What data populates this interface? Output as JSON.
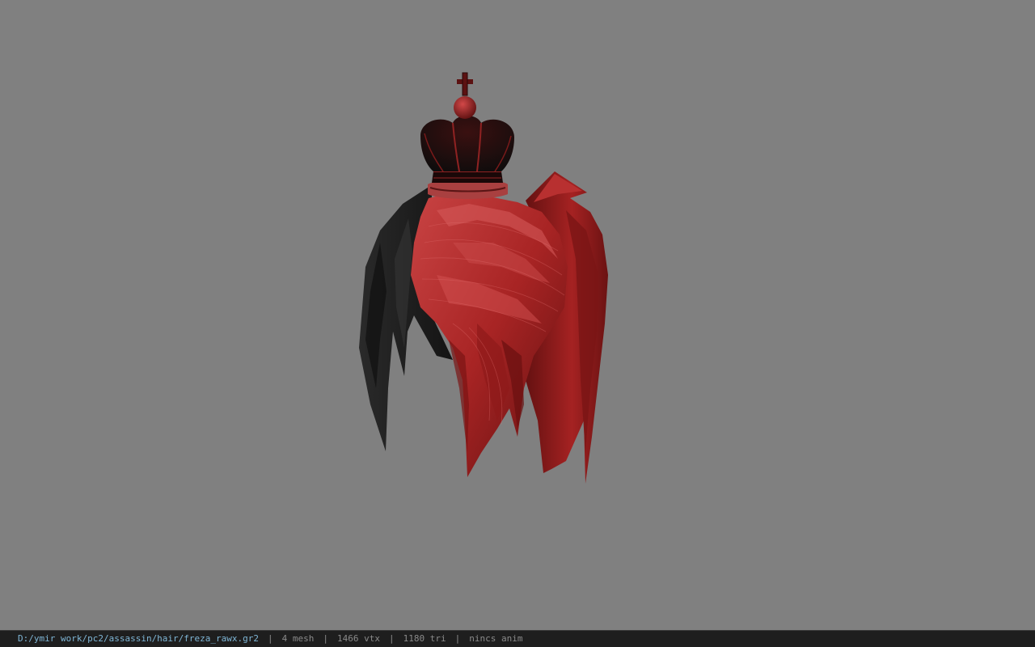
{
  "viewer": {
    "background_color": "#808080",
    "model_colors": {
      "hair_red": "#b52a2a",
      "hair_dark": "#6b1212",
      "hair_black": "#1e1e1e",
      "crown_black": "#141414",
      "crown_red": "#8f1c1c"
    }
  },
  "statusbar": {
    "path": "D:/ymir work/pc2/assassin/hair/freza_rawx.gr2",
    "separator": "|",
    "mesh": "4 mesh",
    "vertices": "1466 vtx",
    "triangles": "1180 tri",
    "anim": "nincs anim"
  }
}
